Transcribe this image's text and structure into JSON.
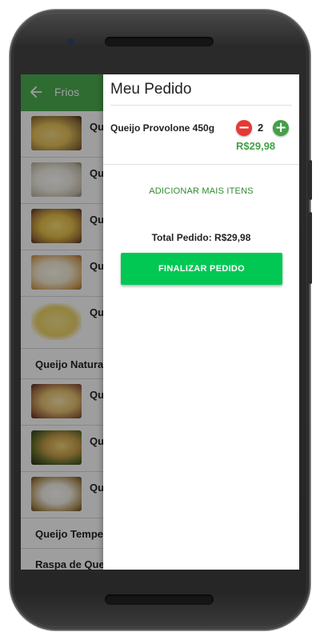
{
  "app_bar": {
    "title": "Frios",
    "back_icon": "arrow-left-icon",
    "color": "#4caf50"
  },
  "product_list": [
    {
      "label": "Queijo",
      "thumb": "yellow"
    },
    {
      "label": "Queijo",
      "thumb": "white"
    },
    {
      "label": "Queijo",
      "thumb": "yellow"
    },
    {
      "label": "Queijo",
      "thumb": "white"
    },
    {
      "label": "Queijo",
      "thumb": "yellow"
    },
    {
      "label": "Queijo Natural"
    },
    {
      "label": "Queijo",
      "thumb": "yellow"
    },
    {
      "label": "Queijo",
      "thumb": "yellow"
    },
    {
      "label": "Queijo",
      "thumb": "white"
    },
    {
      "label": "Queijo Temper"
    },
    {
      "label": "Raspa de Queij"
    }
  ],
  "order_drawer": {
    "title": "Meu Pedido",
    "items": [
      {
        "name": "Queijo Provolone 450g",
        "quantity": "2",
        "price": "R$29,98"
      }
    ],
    "minus_icon": "minus-circle-icon",
    "plus_icon": "plus-circle-icon",
    "add_more_label": "ADICIONAR MAIS ITENS",
    "total_label": "Total Pedido: R$29,98",
    "finish_label": "FINALIZAR PEDIDO",
    "accent_color": "#00c853",
    "price_color": "#43a047"
  }
}
